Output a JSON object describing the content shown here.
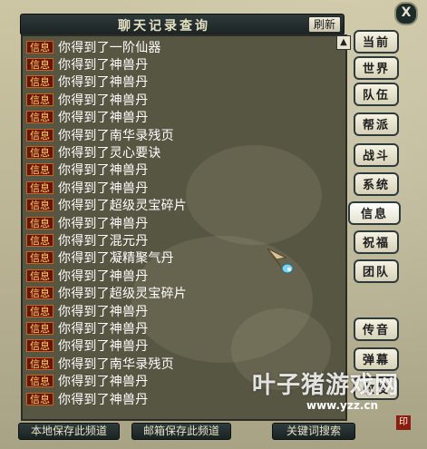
{
  "window": {
    "title": "聊天记录查询",
    "refresh_label": "刷新",
    "close_label": "X",
    "scroll_label": "▲"
  },
  "log": {
    "tag": "信息",
    "rows": [
      "你得到了一阶仙器",
      "你得到了神兽丹",
      "你得到了神兽丹",
      "你得到了神兽丹",
      "你得到了神兽丹",
      "你得到了南华录残页",
      "你得到了灵心要诀",
      "你得到了神兽丹",
      "你得到了神兽丹",
      "你得到了超级灵宝碎片",
      "你得到了神兽丹",
      "你得到了混元丹",
      "你得到了凝精聚气丹",
      "你得到了神兽丹",
      "你得到了超级灵宝碎片",
      "你得到了神兽丹",
      "你得到了神兽丹",
      "你得到了神兽丹",
      "你得到了南华录残页",
      "你得到了神兽丹",
      "你得到了神兽丹"
    ]
  },
  "tabs": [
    {
      "label": "当前",
      "active": false
    },
    {
      "label": "世界",
      "active": false
    },
    {
      "label": "队伍",
      "active": false
    },
    {
      "label": "帮派",
      "active": false
    },
    {
      "label": "战斗",
      "active": false
    },
    {
      "label": "系统",
      "active": false
    },
    {
      "label": "信息",
      "active": true
    },
    {
      "label": "祝福",
      "active": false
    },
    {
      "label": "团队",
      "active": false
    },
    {
      "label": "传音",
      "active": false
    },
    {
      "label": "弹幕",
      "active": false
    },
    {
      "label": "收发",
      "active": false
    }
  ],
  "bottom_buttons": {
    "save_local": "本地保存此频道",
    "mail_save": "邮箱保存此频道",
    "keyword_search": "关键词搜索"
  },
  "watermark": {
    "brand": "叶子猪游戏网",
    "url": "www.yzz.cn"
  }
}
